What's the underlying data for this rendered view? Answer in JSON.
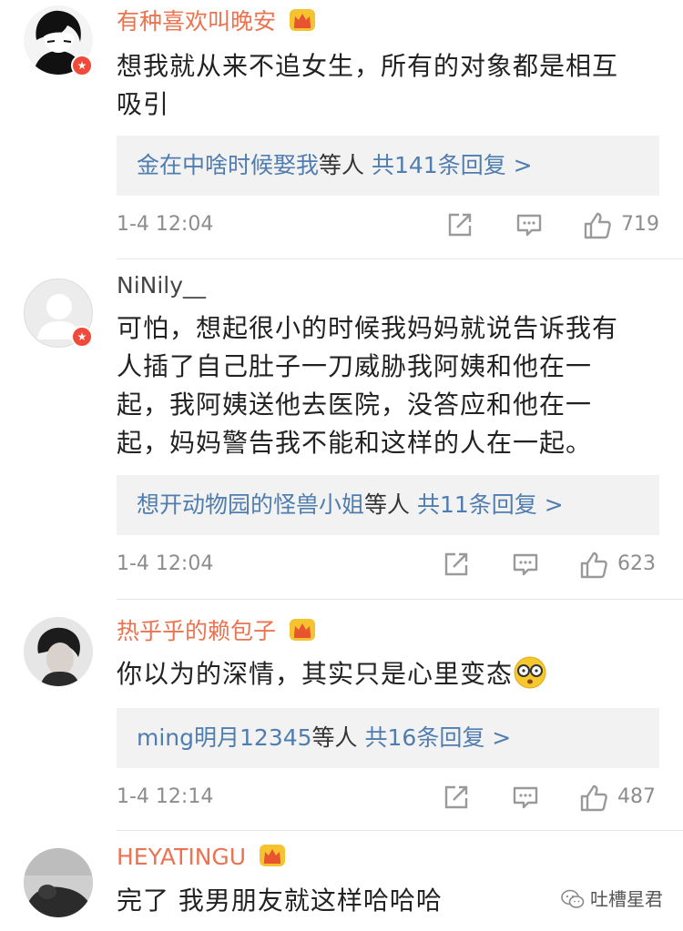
{
  "comments": [
    {
      "username": "有种喜欢叫晚安",
      "text_line1": "想我就从来不追女生，所有的对象都是相互",
      "text_line2": "吸引",
      "replies": {
        "who": "金在中啥时候娶我",
        "sep": "等人",
        "count": "共141条回复 >"
      },
      "time": "1-4 12:04",
      "likes": "719"
    },
    {
      "username": "NiNily__",
      "text_line1": "可怕，想起很小的时候我妈妈就说告诉我有",
      "text_line2": "人插了自己肚子一刀威胁我阿姨和他在一",
      "text_line3": "起，我阿姨送他去医院，没答应和他在一",
      "text_line4": "起，妈妈警告我不能和这样的人在一起。",
      "replies": {
        "who": "想开动物园的怪兽小姐",
        "sep": "等人",
        "count": "共11条回复 >"
      },
      "time": "1-4 12:04",
      "likes": "623"
    },
    {
      "username": "热乎乎的赖包子",
      "text_line1": "你以为的深情，其实只是心里变态",
      "replies": {
        "who": "ming明月12345",
        "sep": "等人",
        "count": "共16条回复 >"
      },
      "time": "1-4 12:14",
      "likes": "487"
    },
    {
      "username": "HEYATINGU",
      "text_line1": "完了 我男朋友就这样哈哈哈"
    }
  ],
  "watermark": {
    "label": "吐槽星君"
  },
  "colors": {
    "vip_name": "#eb7350",
    "reply_link": "#507daf",
    "badge": "#f04b3a"
  }
}
